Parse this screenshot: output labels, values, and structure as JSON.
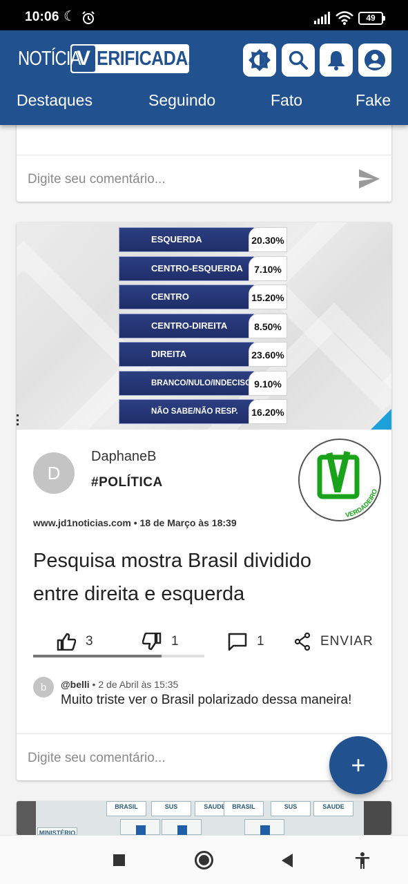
{
  "status_bar": {
    "time": "10:06",
    "battery": "49"
  },
  "app": {
    "logo_prefix": "NOTÍCIA",
    "logo_v": "V",
    "logo_rest": "ERIFICADA."
  },
  "tabs": [
    "Destaques",
    "Seguindo",
    "Fato",
    "Fake"
  ],
  "comment_placeholder": "Digite seu comentário...",
  "post": {
    "image_chart": {
      "type": "bar",
      "categories": [
        "ESQUERDA",
        "CENTRO-ESQUERDA",
        "CENTRO",
        "CENTRO-DIREITA",
        "DIREITA",
        "BRANCO/NULO/INDECISO",
        "NÃO SABE/NÃO RESP."
      ],
      "value_labels": [
        "20.30%",
        "7.10%",
        "15.20%",
        "8.50%",
        "23.60%",
        "9.10%",
        "16.20%"
      ]
    },
    "avatar_letter": "D",
    "author": "DaphaneB",
    "tag": "#POLÍTICA",
    "seal_label": "VERDADEIRO",
    "source": "www.jd1noticias.com • 18 de Março às 18:39",
    "title": "Pesquisa mostra Brasil dividido entre direita e esquerda",
    "likes": "3",
    "dislikes": "1",
    "comments_count": "1",
    "share_label": "ENVIAR",
    "like_ratio": 0.75,
    "comment": {
      "avatar_letter": "b",
      "user": "@belli",
      "date": "2 de Abril às 15:35",
      "text": "Muito triste ver o Brasil polarizado dessa maneira!"
    }
  },
  "next_post_labels": [
    "BRASIL",
    "SUS",
    "SAUDE",
    "BRASIL",
    "SUS",
    "SAUDE",
    "MINISTÉRIO DA"
  ],
  "fab_label": "+",
  "colors": {
    "primary": "#22518f",
    "verified_green": "#1aa31a"
  }
}
